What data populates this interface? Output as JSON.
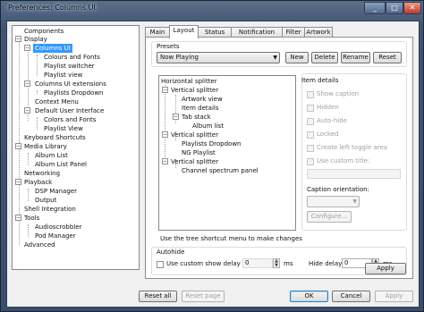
{
  "window": {
    "title": "Preferences: Columns UI"
  },
  "tree": [
    {
      "label": "Components"
    },
    {
      "label": "Display"
    },
    {
      "label": "Columns UI"
    },
    {
      "label": "Colours and Fonts"
    },
    {
      "label": "Playlist switcher"
    },
    {
      "label": "Playlist view"
    },
    {
      "label": "Columns UI extensions"
    },
    {
      "label": "Playlists Dropdown"
    },
    {
      "label": "Context Menu"
    },
    {
      "label": "Default User Interface"
    },
    {
      "label": "Colors and Fonts"
    },
    {
      "label": "Playlist View"
    },
    {
      "label": "Keyboard Shortcuts"
    },
    {
      "label": "Media Library"
    },
    {
      "label": "Album List"
    },
    {
      "label": "Album List Panel"
    },
    {
      "label": "Networking"
    },
    {
      "label": "Playback"
    },
    {
      "label": "DSP Manager"
    },
    {
      "label": "Output"
    },
    {
      "label": "Shell Integration"
    },
    {
      "label": "Tools"
    },
    {
      "label": "Audioscrobbler"
    },
    {
      "label": "Pod Manager"
    },
    {
      "label": "Advanced"
    }
  ],
  "tabs": [
    "Main",
    "Layout",
    "Status bar",
    "Notification area",
    "Filter",
    "Artwork"
  ],
  "presets": {
    "label": "Presets",
    "selected": "Now Playing",
    "buttons": [
      "New",
      "Delete",
      "Rename",
      "Reset"
    ]
  },
  "layout_tree": [
    {
      "label": "Horizontal splitter"
    },
    {
      "label": "Vertical splitter"
    },
    {
      "label": "Artwork view"
    },
    {
      "label": "Item details"
    },
    {
      "label": "Tab stack"
    },
    {
      "label": "Album list"
    },
    {
      "label": "Vertical splitter"
    },
    {
      "label": "Playlists Dropdown"
    },
    {
      "label": "NG Playlist"
    },
    {
      "label": "Vertical splitter"
    },
    {
      "label": "Channel spectrum panel"
    }
  ],
  "hint": "Use the tree shortcut menu to make changes",
  "item_details": {
    "title": "Item details",
    "checkboxes": [
      "Show caption",
      "Hidden",
      "Auto-hide",
      "Locked",
      "Create left toggle area",
      "Use custom title:"
    ],
    "orientation_label": "Caption orientation:",
    "configure": "Configure..."
  },
  "autohide": {
    "title": "Autohide",
    "show_delay_label": "Use custom show delay of",
    "show_delay_value": "0",
    "hide_delay_label": "Hide delay:",
    "hide_delay_value": "0",
    "unit": "ms"
  },
  "buttons": {
    "apply": "Apply",
    "reset_all": "Reset all",
    "reset_page": "Reset page",
    "ok": "OK",
    "cancel": "Cancel",
    "apply_bottom": "Apply"
  }
}
